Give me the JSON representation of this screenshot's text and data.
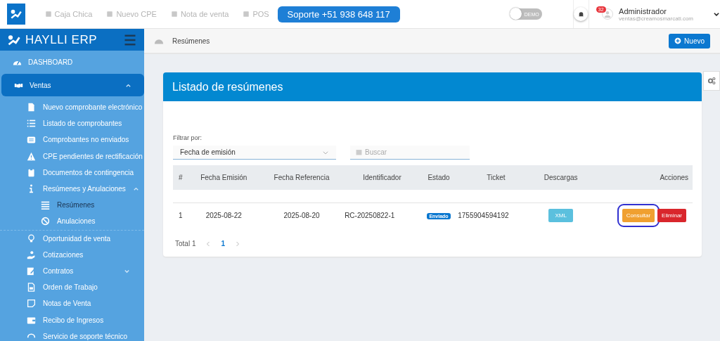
{
  "topbar": {
    "links": [
      "Caja Chica",
      "Nuevo CPE",
      "Nota de venta",
      "POS"
    ],
    "support": "Soporte +51 938 648 117",
    "demo": {
      "label": "DEMO",
      "on": false
    },
    "notifications": "32",
    "user": {
      "name": "Administrador",
      "email": "ventas@creamosmarcati.com"
    }
  },
  "sidebar": {
    "brand": "HAYLLI ERP",
    "items": [
      {
        "label": "DASHBOARD",
        "selected": false
      },
      {
        "label": "Ventas",
        "selected": true,
        "expanded": true,
        "children": [
          {
            "label": "Nuevo comprobante electrónico",
            "selected": false
          },
          {
            "label": "Listado de comprobantes",
            "selected": false
          },
          {
            "label": "Comprobantes no enviados",
            "selected": false
          },
          {
            "label": "CPE pendientes de rectificación",
            "selected": false
          },
          {
            "label": "Documentos de contingencia",
            "selected": false
          },
          {
            "label": "Resúmenes y Anulaciones",
            "selected": false,
            "expanded": true,
            "children": [
              {
                "label": "Resúmenes",
                "selected": true
              },
              {
                "label": "Anulaciones",
                "selected": false
              }
            ]
          },
          {
            "label": "Oportunidad de venta",
            "selected": false
          },
          {
            "label": "Cotizaciones",
            "selected": false
          },
          {
            "label": "Contratos",
            "selected": false,
            "expanded": false
          },
          {
            "label": "Orden de Trabajo",
            "selected": false
          },
          {
            "label": "Notas de Venta",
            "selected": false
          },
          {
            "label": "Recibo de Ingresos",
            "selected": false
          },
          {
            "label": "Servicio de soporte técnico",
            "selected": false
          }
        ]
      }
    ]
  },
  "breadcrumb": "Resúmenes",
  "new_button": "Nuevo",
  "card": {
    "title": "Listado de resúmenes",
    "filter_label": "Filtrar por:",
    "filter_value": "Fecha de emisión",
    "search_placeholder": "Buscar",
    "table": {
      "columns": [
        "#",
        "Fecha Emisión",
        "Fecha Referencia",
        "Identificador",
        "Estado",
        "Ticket",
        "Descargas",
        "Acciones"
      ],
      "rows": [
        {
          "number": "1",
          "issue_date": "2025-08-22",
          "reference_date": "2025-08-20",
          "identifier": "RC-20250822-1",
          "status": "Enviado",
          "ticket": "1755904594192",
          "download": "XML",
          "actions": [
            {
              "label": "Consultar",
              "kind": "warning",
              "highlighted": true
            },
            {
              "label": "Eliminar",
              "kind": "danger",
              "highlighted": false
            }
          ]
        }
      ]
    },
    "pagination": {
      "total": "Total 1",
      "pages": [
        {
          "label": "1",
          "selected": true
        }
      ]
    }
  }
}
